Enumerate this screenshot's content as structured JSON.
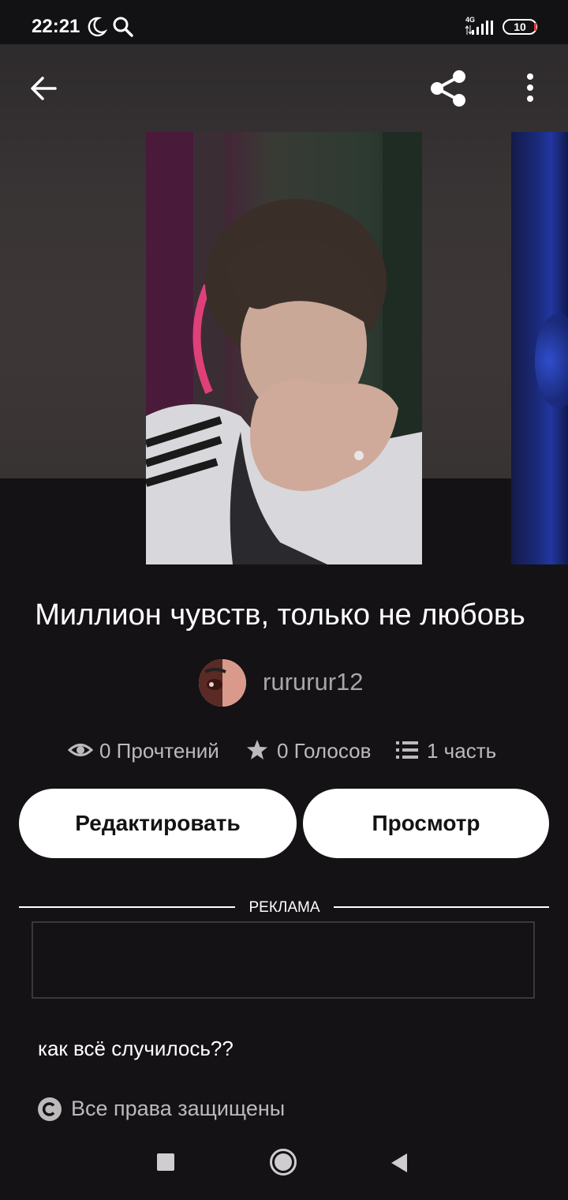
{
  "status_bar": {
    "time": "22:21",
    "network": "4G",
    "battery": "10"
  },
  "header": {
    "back_icon": "arrow-left-icon",
    "share_icon": "share-icon",
    "menu_icon": "more-vertical-icon"
  },
  "story": {
    "title": "Миллион чувств, только не любовь",
    "author": "rururur12",
    "stats": {
      "reads": "0 Прочтений",
      "votes": "0 Голосов",
      "parts": "1 часть"
    },
    "description": "как всё случилось??",
    "copyright": "Все права защищены"
  },
  "actions": {
    "edit_label": "Редактировать",
    "preview_label": "Просмотр"
  },
  "ad": {
    "label": "РЕКЛАМА"
  },
  "colors": {
    "background": "#141215",
    "button_bg": "#ffffff",
    "muted_text": "#bdbabc"
  }
}
